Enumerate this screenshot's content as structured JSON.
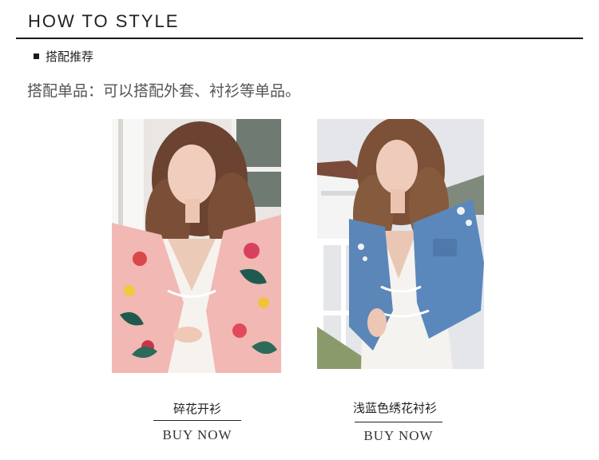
{
  "header": {
    "title": "HOW TO STYLE"
  },
  "section": {
    "subheading": "搭配推荐",
    "description": "搭配单品：可以搭配外套、衬衫等单品。"
  },
  "products": [
    {
      "name": "碎花开衫",
      "cta": "BUY NOW",
      "image_icon": "floral-cardigan-photo"
    },
    {
      "name": "浅蓝色绣花衬衫",
      "cta": "BUY NOW",
      "image_icon": "embroidered-denim-shirt-photo"
    }
  ],
  "colors": {
    "text": "#222222",
    "rule": "#1a1a1a",
    "cardigan_pink": "#f2b8b4",
    "denim_blue": "#5b86b8"
  }
}
